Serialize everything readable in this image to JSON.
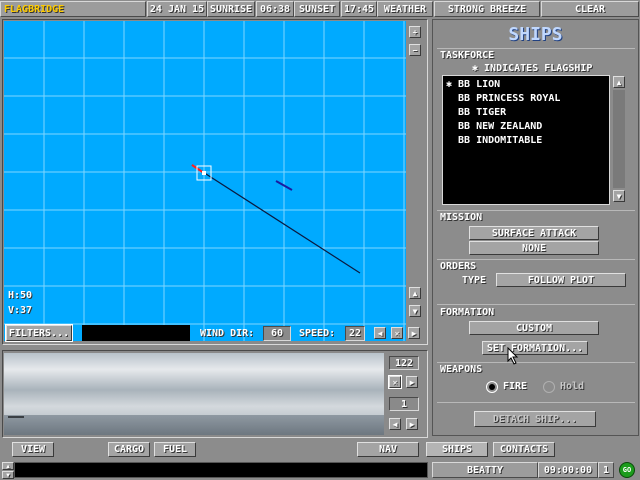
{
  "topbar": {
    "title": "FLAGBRIDGE",
    "date": "24 JAN 15",
    "sunrise_label": "SUNRISE",
    "sunrise": "06:38",
    "sunset_label": "SUNSET",
    "sunset": "17:45",
    "weather_label": "WEATHER",
    "weather": "STRONG BREEZE",
    "sky": "CLEAR"
  },
  "map": {
    "h_label": "H:50",
    "v_label": "V:37",
    "filters_label": "FILTERS...",
    "wind_dir_label": "WIND DIR:",
    "wind_dir": "60",
    "speed_label": "SPEED:",
    "speed": "22",
    "water_color": "#00aaff",
    "grid_color": "#7fd6ff"
  },
  "view": {
    "counter_top": "122",
    "counter_bottom": "1"
  },
  "panel": {
    "title": "SHIPS",
    "taskforce_label": "TASKFORCE",
    "flag_note": "✱ INDICATES FLAGSHIP",
    "ships": [
      "✱ BB LION",
      "  BB PRINCESS ROYAL",
      "  BB TIGER",
      "  BB NEW ZEALAND",
      "  BB INDOMITABLE"
    ],
    "mission_label": "MISSION",
    "mission_primary": "SURFACE ATTACK",
    "mission_secondary": "NONE",
    "orders_label": "ORDERS",
    "type_label": "TYPE",
    "orders_type": "FOLLOW PLOT",
    "formation_label": "FORMATION",
    "formation_value": "CUSTOM",
    "set_formation_label": "SET FORMATION...",
    "weapons_label": "WEAPONS",
    "fire_label": "FIRE",
    "hold_label": "Hold",
    "detach_label": "DETACH SHIP..."
  },
  "bottom_tabs": {
    "view": "VIEW",
    "cargo": "CARGO",
    "fuel": "FUEL",
    "nav": "NAV",
    "ships": "SHIPS",
    "contacts": "CONTACTS"
  },
  "status": {
    "commander": "BEATTY",
    "time": "09:00:00",
    "speed_mult": "1",
    "go": "GO"
  }
}
